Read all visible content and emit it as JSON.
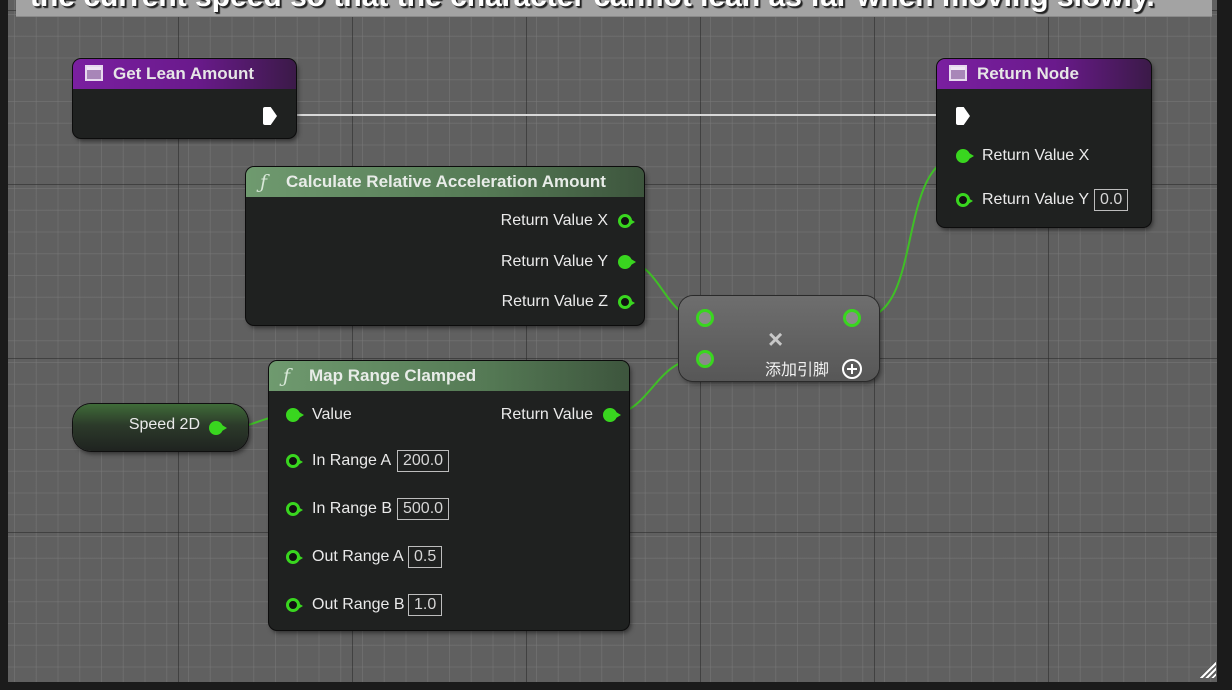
{
  "comment": {
    "text": "the current speed so that the character cannot lean as far when moving slowly."
  },
  "nodes": {
    "get_lean_amount": {
      "title": "Get Lean Amount",
      "icon": "event-node-icon"
    },
    "return_node": {
      "title": "Return Node",
      "icon": "event-node-icon",
      "pins": [
        {
          "label": "Return Value X",
          "connected": true
        },
        {
          "label": "Return Value Y",
          "connected": false,
          "value": "0.0"
        }
      ]
    },
    "calc_accel": {
      "title": "Calculate Relative Acceleration Amount",
      "icon": "function-icon",
      "outputs": [
        {
          "label": "Return Value X",
          "connected": false
        },
        {
          "label": "Return Value Y",
          "connected": true
        },
        {
          "label": "Return Value Z",
          "connected": false
        }
      ]
    },
    "multiply": {
      "symbol": "×",
      "add_pin_label": "添加引脚",
      "add_pin_icon": "plus-circle-icon"
    },
    "speed_2d": {
      "label": "Speed 2D"
    },
    "map_range": {
      "title": "Map Range Clamped",
      "icon": "function-icon",
      "value_label": "Value",
      "return_label": "Return Value",
      "inputs": [
        {
          "label": "In Range A",
          "value": "200.0"
        },
        {
          "label": "In Range B",
          "value": "500.0"
        },
        {
          "label": "Out Range A",
          "value": "0.5"
        },
        {
          "label": "Out Range B",
          "value": "1.0"
        }
      ]
    }
  },
  "colors": {
    "float_pin": "#39d61f",
    "event_header": "#7a1fa0",
    "function_header": "#6f9a6f",
    "grid_bg": "#606060"
  }
}
